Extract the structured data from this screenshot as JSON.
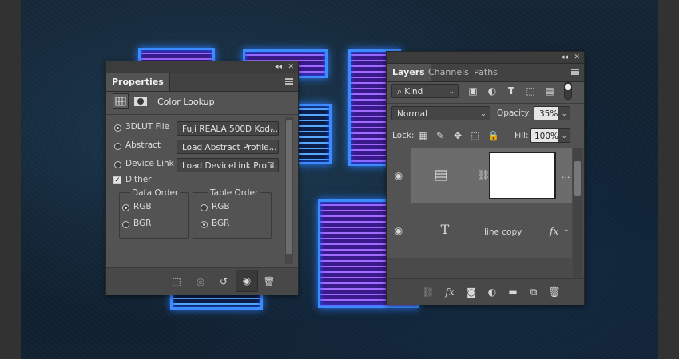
{
  "properties": {
    "tab": "Properties",
    "title": "Color Lookup",
    "collapse_glyph": "◂◂",
    "close_glyph": "✕",
    "rows": [
      {
        "label": "3DLUT File",
        "value": "Fuji REALA 500D Kod...",
        "selected": true
      },
      {
        "label": "Abstract",
        "value": "Load Abstract Profile...",
        "selected": false
      },
      {
        "label": "Device Link",
        "value": "Load DeviceLink Profil...",
        "selected": false
      }
    ],
    "dither": {
      "label": "Dither",
      "checked": true
    },
    "data_order": {
      "title": "Data Order",
      "options": [
        "RGB",
        "BGR"
      ],
      "selected": "RGB"
    },
    "table_order": {
      "title": "Table Order",
      "options": [
        "RGB",
        "BGR"
      ],
      "selected": "BGR"
    },
    "footer_icons": [
      "clip-to-layer-icon",
      "view-previous-state-icon",
      "reset-icon",
      "visibility-icon",
      "delete-icon"
    ]
  },
  "layers": {
    "tabs": [
      "Layers",
      "Channels",
      "Paths"
    ],
    "active_tab": "Layers",
    "filter_kind": "Kind",
    "blend_mode": "Normal",
    "opacity_label": "Opacity:",
    "opacity_value": "35%",
    "lock_label": "Lock:",
    "fill_label": "Fill:",
    "fill_value": "100%",
    "rows": [
      {
        "name": "",
        "type": "adjustment",
        "visible": true
      },
      {
        "name": "line copy",
        "type": "text",
        "visible": true,
        "fx": "fx"
      }
    ]
  }
}
